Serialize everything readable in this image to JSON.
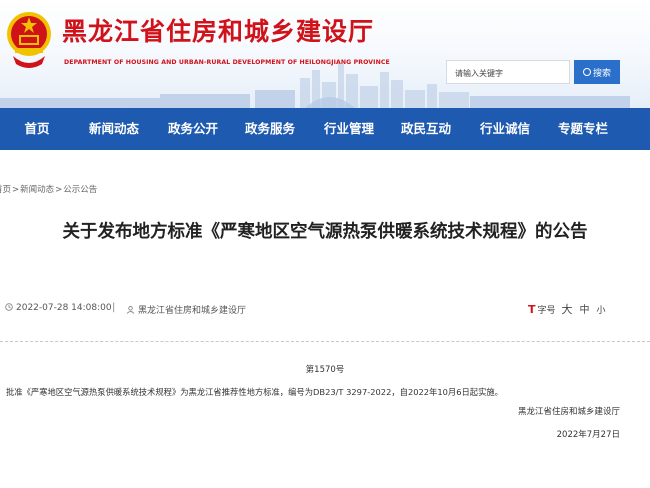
{
  "header": {
    "site_title": "黑龙江省住房和城乡建设厅",
    "site_subtitle": "DEPARTMENT OF HOUSING AND URBAN-RURAL DEVELOPMENT OF HEILONGJIANG PROVINCE",
    "search_placeholder": "请输入关键字",
    "search_button": "搜索"
  },
  "nav": {
    "items": [
      "首页",
      "新闻动态",
      "政务公开",
      "政务服务",
      "行业管理",
      "政民互动",
      "行业诚信",
      "专题专栏"
    ]
  },
  "breadcrumb": {
    "items": [
      "首页",
      "新闻动态",
      "公示公告"
    ],
    "separator": ">"
  },
  "article": {
    "title": "关于发布地方标准《严寒地区空气源热泵供暖系统技术规程》的公告",
    "date": "2022-07-28 14:08:00",
    "divider": "|",
    "source": "黑龙江省住房和城乡建设厅",
    "font_size_label": "字号",
    "font_size_large": "大",
    "font_size_medium": "中",
    "font_size_small": "小",
    "doc_number": "第1570号",
    "body": "批准《严寒地区空气源热泵供暖系统技术规程》为黑龙江省推荐性地方标准，编号为DB23/T 3297-2022，自2022年10月6日起实施。",
    "signature": "黑龙江省住房和城乡建设厅",
    "sign_date": "2022年7月27日"
  },
  "colors": {
    "brand_red": "#d0121a",
    "nav_blue": "#1e5aaf",
    "search_blue": "#2a6fc9"
  }
}
